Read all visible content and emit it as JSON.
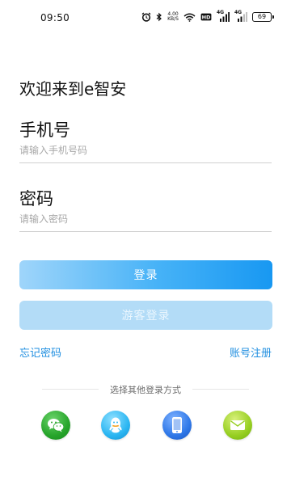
{
  "status_bar": {
    "time": "09:50",
    "net_speed_value": "4.00",
    "net_speed_unit": "KB/S",
    "signal_label_1": "4G",
    "signal_label_2": "4G",
    "battery": "69",
    "icons": [
      "alarm-icon",
      "bluetooth-icon",
      "wifi-icon",
      "hd-icon",
      "signal-icon",
      "signal-icon",
      "battery-icon"
    ]
  },
  "login": {
    "welcome": "欢迎来到e智安",
    "phone_label": "手机号",
    "phone_placeholder": "请输入手机号码",
    "phone_value": "",
    "password_label": "密码",
    "password_placeholder": "请输入密码",
    "password_value": "",
    "login_button": "登录",
    "guest_button": "游客登录",
    "forgot_password": "忘记密码",
    "register": "账号注册"
  },
  "other_login": {
    "title": "选择其他登录方式",
    "methods": [
      {
        "icon": "wechat-icon",
        "color": "#27a52b"
      },
      {
        "icon": "qq-icon",
        "color": "#2bb6f2"
      },
      {
        "icon": "phone-icon",
        "color": "#2f78e8"
      },
      {
        "icon": "mail-icon",
        "color": "#97cf22"
      }
    ]
  },
  "colors": {
    "accent": "#1898f2",
    "link": "#1e8ee0",
    "guest_button": "#b3dcf7"
  }
}
